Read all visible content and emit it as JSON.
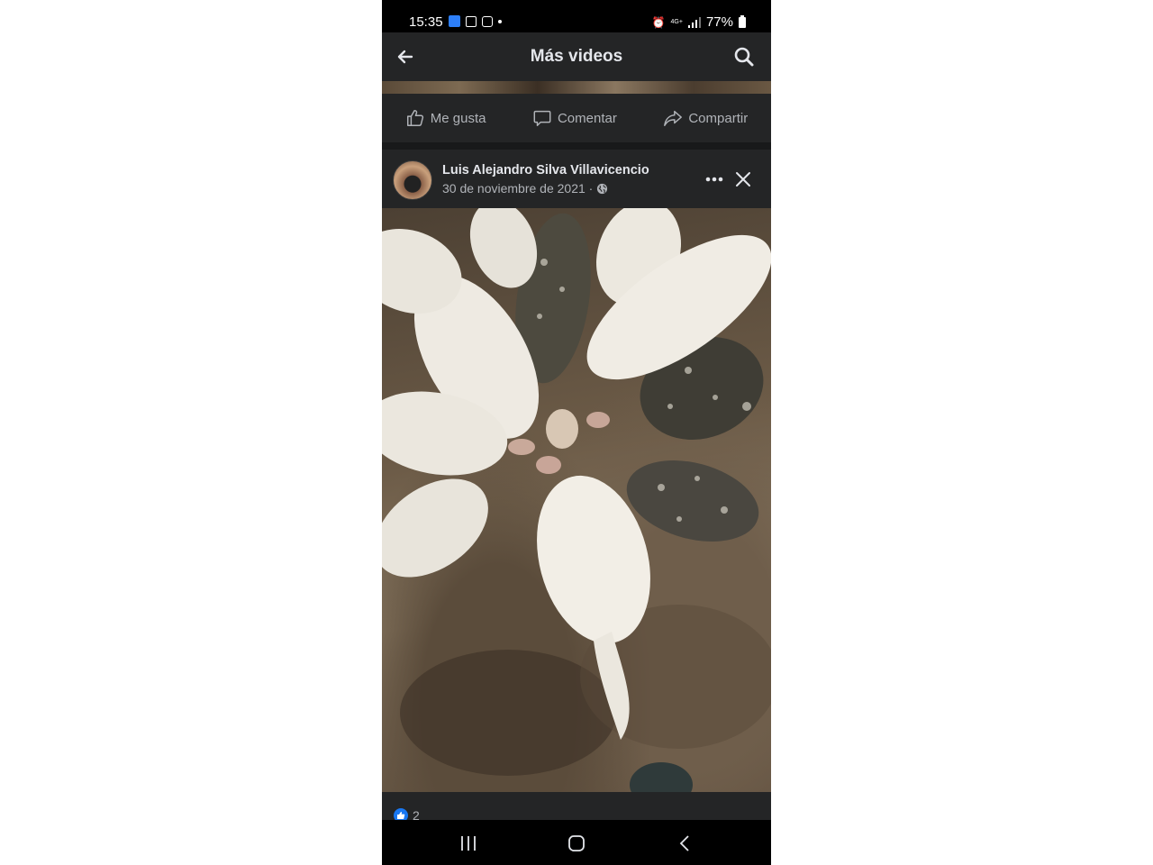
{
  "status_bar": {
    "time": "15:35",
    "network": "4G+",
    "battery": "77%"
  },
  "header": {
    "title": "Más videos",
    "back_icon": "arrow-left-icon",
    "search_icon": "search-icon"
  },
  "actions": {
    "like_label": "Me gusta",
    "comment_label": "Comentar",
    "share_label": "Compartir"
  },
  "post": {
    "author": "Luis Alejandro Silva Villavicencio",
    "date": "30 de noviembre de 2021 ·",
    "privacy_icon": "globe-icon"
  },
  "reactions": {
    "like_count": "2"
  },
  "colors": {
    "background": "#18191a",
    "surface": "#242526",
    "text_primary": "#e4e6eb",
    "text_secondary": "#b0b3b8",
    "like_blue": "#1877f2"
  }
}
